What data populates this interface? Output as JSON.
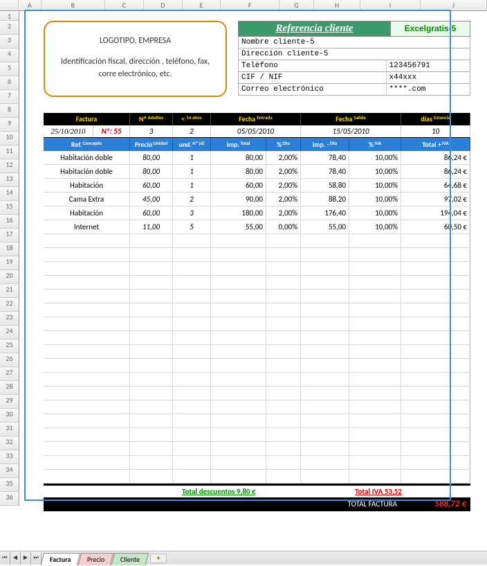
{
  "columns": [
    "A",
    "B",
    "C",
    "D",
    "E",
    "F",
    "G",
    "H",
    "I",
    "J"
  ],
  "row_numbers_visible": [
    1,
    2,
    3,
    4,
    5,
    6,
    7,
    8,
    9,
    10,
    11,
    12,
    13,
    14,
    15,
    16,
    17,
    18,
    19,
    20,
    21,
    22,
    23,
    24,
    25,
    26,
    27,
    28,
    29,
    30,
    31,
    32,
    33,
    34,
    35,
    36
  ],
  "logo": {
    "title": "LOGOTIPO, EMPRESA",
    "subtitle": "Identificación fiscal, dirección , teléfono, fax, corre electrónico, etc."
  },
  "client_ref": {
    "header_left": "Referencia cliente",
    "header_right": "Excelgratis-5",
    "rows": [
      {
        "label": "Nombre cliente-5",
        "value": ""
      },
      {
        "label": "Dirección cliente-5",
        "value": ""
      },
      {
        "label": "Teléfono",
        "value": "123456791"
      },
      {
        "label": "CIF / NIF",
        "value": "x44xxx"
      },
      {
        "label": "Correo electrónico",
        "value": "****.com"
      }
    ]
  },
  "inv_headers": {
    "factura": "Factura",
    "no": "Nº",
    "no_sup": "Adultos",
    "lt": "<",
    "lt_sup": "14 años",
    "fecha_ent": "Fecha",
    "fecha_ent_sup": "Entrada",
    "fecha_sal": "Fecha",
    "fecha_sal_sup": "Salida",
    "dias": "días",
    "dias_sup": "Estancia"
  },
  "inv_values": {
    "fecha": "25/10/2010",
    "num_label": "Nº:  55",
    "adultos": "3",
    "menores": "2",
    "entrada": "05/05/2010",
    "salida": "15/05/2010",
    "dias": "10"
  },
  "tbl_headers": {
    "ref": "Ref.",
    "ref_sup": "Concepto",
    "precio": "Precio",
    "precio_sup": "Unidad",
    "und": "und.",
    "und_sup": "Nº (d)",
    "imp": "imp.",
    "imp_sup": "Total",
    "dto": "%",
    "dto_sup": "Dto",
    "impdto": "imp. -",
    "impdto_sup": "Dto",
    "iva": "%",
    "iva_sup": "IVA",
    "total": "Total +",
    "total_sup": "IVA"
  },
  "rows": [
    {
      "concept": "Habitación doble",
      "precio": "80,00",
      "und": "1",
      "imp": "80,00",
      "dto": "2,00%",
      "impdto": "78,40",
      "iva": "10,00%",
      "total": "86,24 €"
    },
    {
      "concept": "Habitación doble",
      "precio": "80,00",
      "und": "1",
      "imp": "80,00",
      "dto": "2,00%",
      "impdto": "78,40",
      "iva": "10,00%",
      "total": "86,24 €"
    },
    {
      "concept": "Habitación",
      "precio": "60,00",
      "und": "1",
      "imp": "60,00",
      "dto": "2,00%",
      "impdto": "58,80",
      "iva": "10,00%",
      "total": "64,68 €"
    },
    {
      "concept": "Cama Extra",
      "precio": "45,00",
      "und": "2",
      "imp": "90,00",
      "dto": "2,00%",
      "impdto": "88,20",
      "iva": "10,00%",
      "total": "97,02 €"
    },
    {
      "concept": "Habitación",
      "precio": "60,00",
      "und": "3",
      "imp": "180,00",
      "dto": "2,00%",
      "impdto": "176,40",
      "iva": "10,00%",
      "total": "194,04 €"
    },
    {
      "concept": "Internet",
      "precio": "11,00",
      "und": "5",
      "imp": "55,00",
      "dto": "0,00%",
      "impdto": "55,00",
      "iva": "10,00%",
      "total": "60,50 €"
    }
  ],
  "empty_rows": 18,
  "totals": {
    "descuentos_label": "Total descuentos 9,80 €",
    "iva_label": "Total IVA 53,52",
    "final_label": "TOTAL  FACTURA",
    "final_value": "588,72 €"
  },
  "tabs": {
    "nav": [
      "⏮",
      "◀",
      "▶",
      "⏭"
    ],
    "items": [
      {
        "label": "Factura",
        "active": true,
        "class": "active"
      },
      {
        "label": "Precio",
        "class": ""
      },
      {
        "label": "Cliente",
        "class": "green"
      }
    ]
  }
}
